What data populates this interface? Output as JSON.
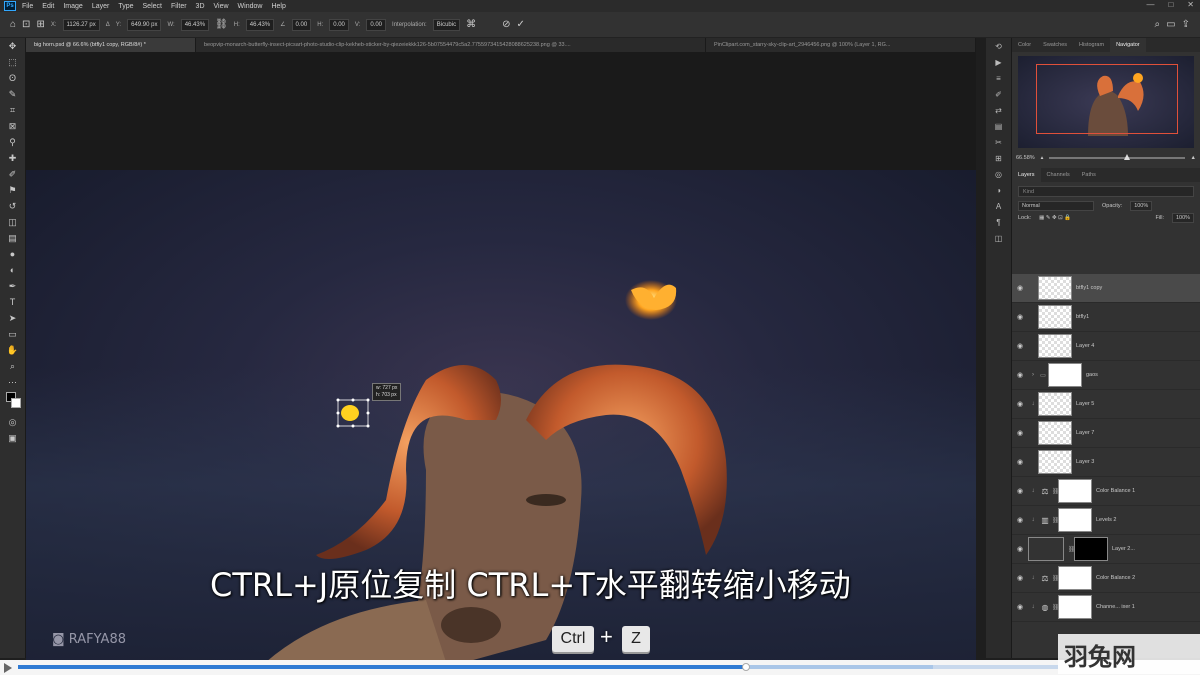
{
  "menubar": {
    "logo": "Ps",
    "items": [
      "File",
      "Edit",
      "Image",
      "Layer",
      "Type",
      "Select",
      "Filter",
      "3D",
      "View",
      "Window",
      "Help"
    ]
  },
  "optbar": {
    "x_value": "1126.27 px",
    "y_value": "649.90 px",
    "w_value": "46.43%",
    "h_value": "46.43%",
    "angle_value": "0.00",
    "h_skew": "0.00",
    "v_skew": "0.00",
    "interp_label": "Interpolation:",
    "interp_value": "Bicubic"
  },
  "tabs": [
    {
      "label": "big horn.psd @ 66.6% (btfly1 copy, RGB/8#) *",
      "active": true
    },
    {
      "label": "beopvip-monarch-butterfly-insect-picsart-photo-studio-clip-kekheb-sticker-by-qiezeiekkk126-5b07554479c5a2.7755973415428088625238.png @ 33....",
      "active": false
    },
    {
      "label": "PinClipart.com_starry-sky-clip-art_2946456.png @ 100% (Layer 1, RG...",
      "active": false
    }
  ],
  "panel_tabs": [
    "Color",
    "Swatches",
    "Histogram",
    "Navigator"
  ],
  "navigator": {
    "zoom": "66.58%"
  },
  "layer_tabs": [
    "Layers",
    "Channels",
    "Paths"
  ],
  "layer_controls": {
    "search_placeholder": "Kind",
    "blend_mode": "Normal",
    "opacity_label": "Opacity:",
    "opacity_value": "100%",
    "lock_label": "Lock:",
    "fill_label": "Fill:",
    "fill_value": "100%"
  },
  "layers": [
    {
      "name": "btfly1 copy",
      "selected": true
    },
    {
      "name": "btfly1",
      "selected": false
    },
    {
      "name": "Layer 4",
      "selected": false
    },
    {
      "name": "gaos",
      "selected": false
    },
    {
      "name": "Layer 5",
      "selected": false
    },
    {
      "name": "Layer 7",
      "selected": false
    },
    {
      "name": "Layer 3",
      "selected": false
    },
    {
      "name": "Color Balance 1",
      "selected": false
    },
    {
      "name": "Levels 2",
      "selected": false
    },
    {
      "name": "Layer 2...",
      "selected": false
    },
    {
      "name": "Color Balance 2",
      "selected": false
    },
    {
      "name": "Channe... ixer 1",
      "selected": false
    }
  ],
  "transform_info": {
    "w": "w: 727 px",
    "h": "h: 703 px"
  },
  "subtitle": "CTRL+J原位复制 CTRL+T水平翻转缩小移动",
  "watermark": "RAFYA88",
  "keys": {
    "key1": "Ctrl",
    "plus": "+",
    "key2": "Z"
  },
  "video": {
    "progress": 0.7,
    "buffered": 0.88
  },
  "brand": "羽兔网",
  "colors": {
    "accent": "#2f7ad3",
    "nav_box": "#e0503a",
    "horn": "#d9703a",
    "butterfly": "#ffa520"
  }
}
